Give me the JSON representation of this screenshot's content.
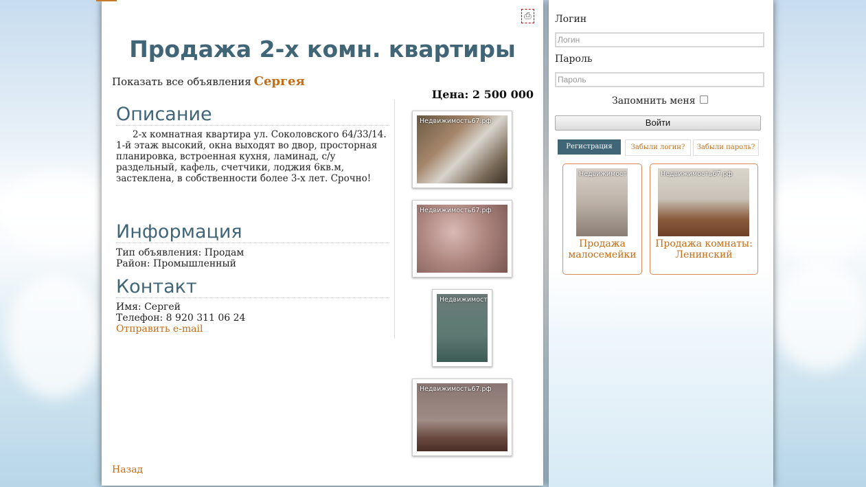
{
  "listing": {
    "title": "Продажа 2-х комн. квартиры",
    "show_all_prefix": "Показать все объявления",
    "seller_genitive": "Сергея",
    "price": "Цена: 2 500 000",
    "print_icon": "printer-icon",
    "description_heading": "Описание",
    "description": "2-х комнатная квартира ул. Соколовского 64/33/14. 1-й этаж высокий, окна выходят во двор, просторная планировка, встроенная кухня, ламинад, с/у раздельный, кафель, счетчики, лоджия 6кв.м, застеклена, в собственности более 3-х лет. Срочно!",
    "info_heading": "Информация",
    "ad_type": "Тип объявления: Продам",
    "district": "Район: Промышленный",
    "contact_heading": "Контакт",
    "contact_name": "Имя: Сергей",
    "contact_phone": "Телефон: 8 920 311 06 24",
    "send_email": "Отправить e-mail",
    "back": "Назад",
    "photo_watermark": "Недвижимость67.рф",
    "photo_watermark_short": "Недвижимост"
  },
  "login": {
    "login_label": "Логин",
    "login_placeholder": "Логин",
    "password_label": "Пароль",
    "password_placeholder": "Пароль",
    "remember": "Запомнить меня",
    "submit": "Войти",
    "register": "Регистрация",
    "forgot_login": "Забыли логин?",
    "forgot_password": "Забыли пароль?"
  },
  "related": [
    {
      "caption": "Продажа малосемейки",
      "watermark": "Недвижимост"
    },
    {
      "caption": "Продажа комнаты: Ленинский",
      "watermark": "Недвижимость67.рф"
    }
  ],
  "colors": {
    "accent": "#3f6577",
    "link": "#c46d14"
  }
}
